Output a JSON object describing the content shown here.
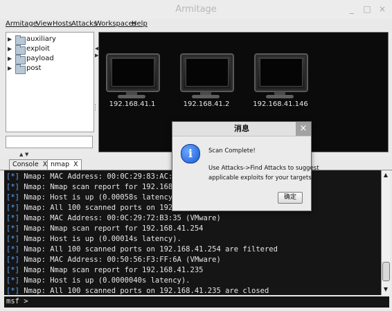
{
  "window": {
    "title": "Armitage",
    "minimize": "_",
    "maximize": "□",
    "close": "×"
  },
  "menu": [
    "Armitage",
    "View",
    "Hosts",
    "Attacks",
    "Workspaces",
    "Help"
  ],
  "tree": {
    "items": [
      "auxiliary",
      "exploit",
      "payload",
      "post"
    ]
  },
  "hosts": [
    "192.168.41.1",
    "192.168.41.2",
    "192.168.41.146"
  ],
  "tabs": [
    {
      "label": "Console",
      "close": "X",
      "active": false
    },
    {
      "label": "nmap",
      "close": "X",
      "active": true
    }
  ],
  "console": {
    "lines": [
      {
        "tag": "[*]",
        "text": " Nmap: MAC Address: 00:0C:29:83:AC:B0 (VMware)"
      },
      {
        "tag": "[*]",
        "text": " Nmap: Nmap scan report for 192.168.41.146"
      },
      {
        "tag": "[*]",
        "text": " Nmap: Host is up (0.00058s latency)."
      },
      {
        "tag": "[*]",
        "text": " Nmap: All 100 scanned ports on 192.168.41.146 are filtered"
      },
      {
        "tag": "[*]",
        "text": " Nmap: MAC Address: 00:0C:29:72:B3:35 (VMware)"
      },
      {
        "tag": "[*]",
        "text": " Nmap: Nmap scan report for 192.168.41.254"
      },
      {
        "tag": "[*]",
        "text": " Nmap: Host is up (0.00014s latency)."
      },
      {
        "tag": "[*]",
        "text": " Nmap: All 100 scanned ports on 192.168.41.254 are filtered"
      },
      {
        "tag": "[*]",
        "text": " Nmap: MAC Address: 00:50:56:F3:FF:6A (VMware)"
      },
      {
        "tag": "[*]",
        "text": " Nmap: Nmap scan report for 192.168.41.235"
      },
      {
        "tag": "[*]",
        "text": " Nmap: Host is up (0.0000040s latency)."
      },
      {
        "tag": "[*]",
        "text": " Nmap: All 100 scanned ports on 192.168.41.235 are closed"
      }
    ],
    "prompt": "msf >"
  },
  "dialog": {
    "title": "消息",
    "close": "×",
    "icon": "info-icon",
    "line1": "Scan Complete!",
    "line2": "Use Attacks->Find Attacks to suggest",
    "line3": "applicable exploits for your targets.",
    "ok_label": "确定"
  },
  "colors": {
    "console_bg": "#151515",
    "console_tag": "#5ea5ff",
    "targets_bg": "#0b0b0b"
  }
}
